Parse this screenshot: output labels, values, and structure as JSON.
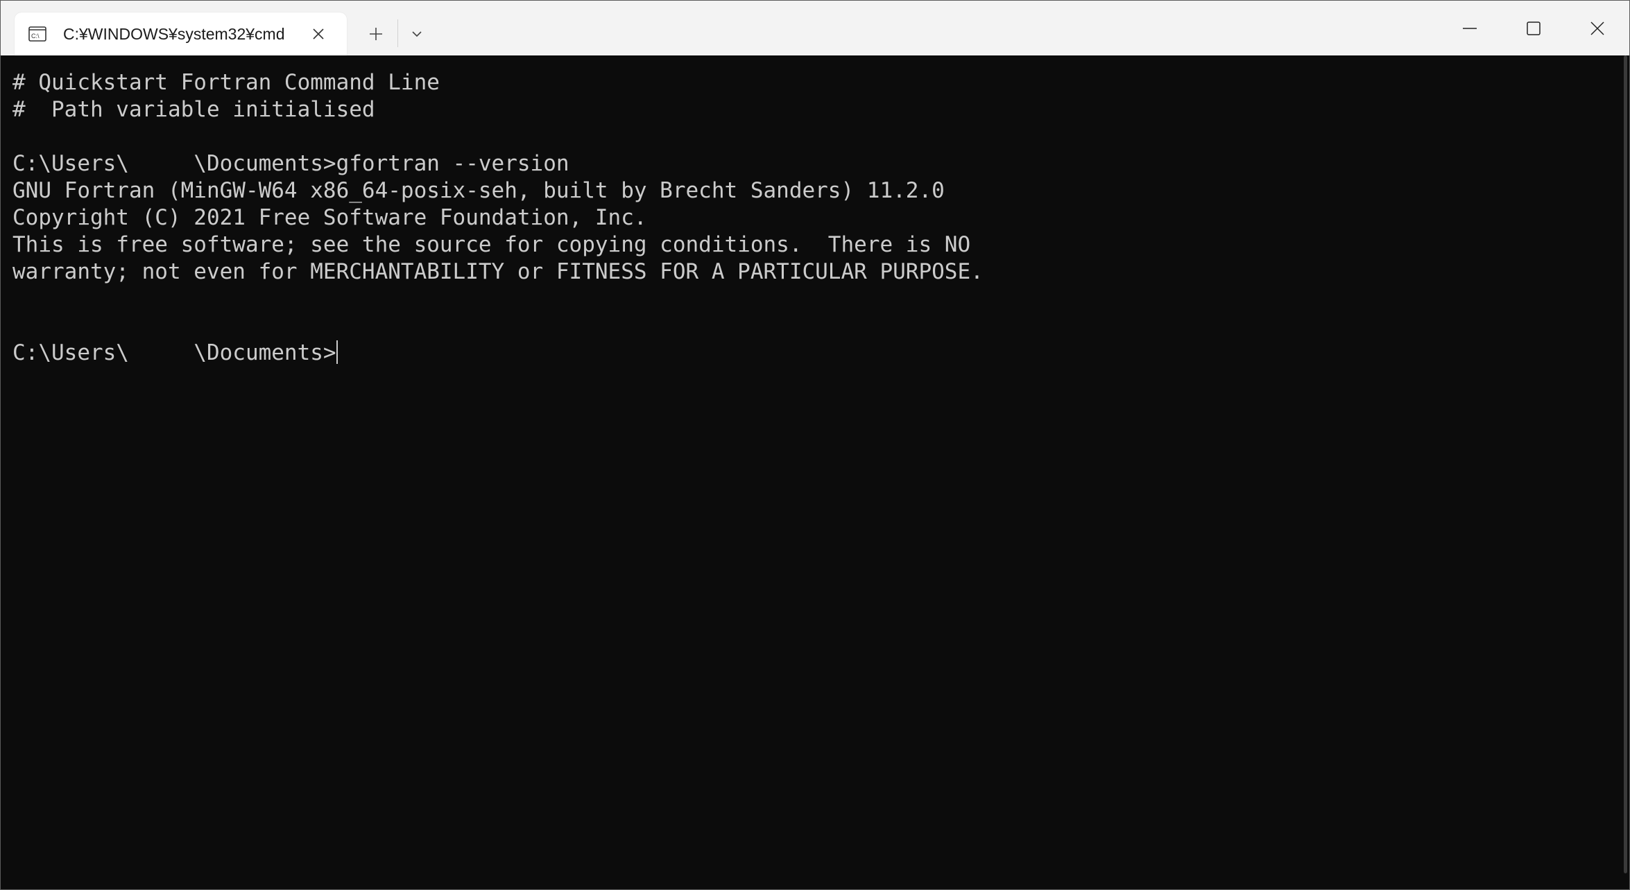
{
  "tab": {
    "title": "C:¥WINDOWS¥system32¥cmd",
    "icon": "terminal-cmd-icon"
  },
  "titlebar": {
    "new_tab_icon": "plus-icon",
    "dropdown_icon": "chevron-down-icon",
    "minimize_icon": "minimize-icon",
    "maximize_icon": "maximize-icon",
    "close_icon": "close-icon"
  },
  "terminal": {
    "lines": [
      "# Quickstart Fortran Command Line",
      "#  Path variable initialised",
      "",
      "C:\\Users\\     \\Documents>gfortran --version",
      "GNU Fortran (MinGW-W64 x86_64-posix-seh, built by Brecht Sanders) 11.2.0",
      "Copyright (C) 2021 Free Software Foundation, Inc.",
      "This is free software; see the source for copying conditions.  There is NO",
      "warranty; not even for MERCHANTABILITY or FITNESS FOR A PARTICULAR PURPOSE.",
      "",
      ""
    ],
    "prompt": "C:\\Users\\     \\Documents>"
  },
  "colors": {
    "background": "#0c0c0c",
    "foreground": "#cccccc",
    "titlebar": "#f3f3f3"
  }
}
